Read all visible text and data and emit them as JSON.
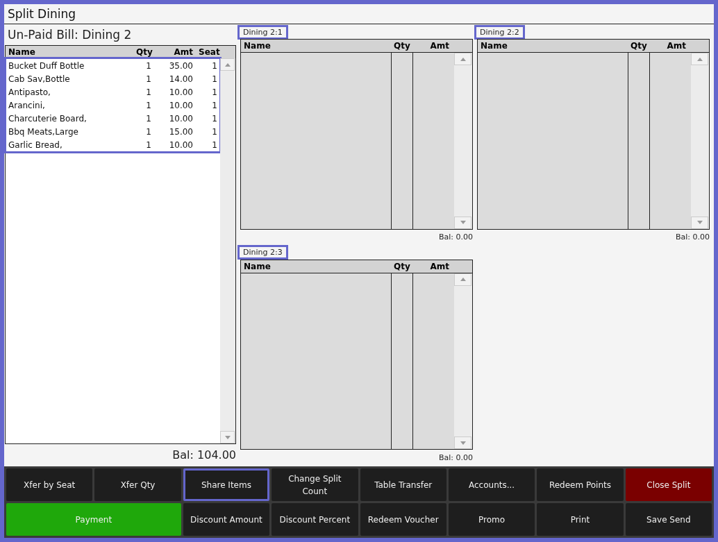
{
  "window": {
    "title": "Split Dining"
  },
  "bill": {
    "title": "Un-Paid Bill: Dining 2",
    "highlighted": true,
    "columns": [
      "Name",
      "Qty",
      "Amt",
      "Seat"
    ],
    "rows": [
      {
        "name": "Bucket Duff Bottle",
        "qty": "1",
        "amt": "35.00",
        "seat": "1"
      },
      {
        "name": "Cab Sav,Bottle",
        "qty": "1",
        "amt": "14.00",
        "seat": "1"
      },
      {
        "name": "Antipasto,",
        "qty": "1",
        "amt": "10.00",
        "seat": "1"
      },
      {
        "name": "Arancini,",
        "qty": "1",
        "amt": "10.00",
        "seat": "1"
      },
      {
        "name": "Charcuterie Board,",
        "qty": "1",
        "amt": "10.00",
        "seat": "1"
      },
      {
        "name": "Bbq Meats,Large",
        "qty": "1",
        "amt": "15.00",
        "seat": "1"
      },
      {
        "name": "Garlic Bread,",
        "qty": "1",
        "amt": "10.00",
        "seat": "1"
      }
    ],
    "balance": "Bal: 104.00"
  },
  "splits": [
    {
      "label": "Dining 2:1",
      "highlighted": true,
      "columns": [
        "Name",
        "Qty",
        "Amt"
      ],
      "balance": "Bal: 0.00"
    },
    {
      "label": "Dining 2:2",
      "highlighted": true,
      "columns": [
        "Name",
        "Qty",
        "Amt"
      ],
      "balance": "Bal: 0.00"
    },
    {
      "label": "Dining 2:3",
      "highlighted": true,
      "columns": [
        "Name",
        "Qty",
        "Amt"
      ],
      "balance": "Bal: 0.00"
    }
  ],
  "buttons": [
    {
      "label": "Xfer by Seat",
      "kind": "normal",
      "highlighted": false
    },
    {
      "label": "Xfer Qty",
      "kind": "normal",
      "highlighted": false
    },
    {
      "label": "Share Items",
      "kind": "normal",
      "highlighted": true
    },
    {
      "label": "Change Split Count",
      "kind": "normal",
      "highlighted": false
    },
    {
      "label": "Table Transfer",
      "kind": "normal",
      "highlighted": false
    },
    {
      "label": "Accounts...",
      "kind": "normal",
      "highlighted": false
    },
    {
      "label": "Redeem Points",
      "kind": "normal",
      "highlighted": false
    },
    {
      "label": "Close Split",
      "kind": "danger",
      "highlighted": false
    },
    {
      "label": "Payment",
      "kind": "primary",
      "highlighted": false
    },
    {
      "label": "Discount Amount",
      "kind": "normal",
      "highlighted": false
    },
    {
      "label": "Discount Percent",
      "kind": "normal",
      "highlighted": false
    },
    {
      "label": "Redeem Voucher",
      "kind": "normal",
      "highlighted": false
    },
    {
      "label": "Promo",
      "kind": "normal",
      "highlighted": false
    },
    {
      "label": "Print",
      "kind": "normal",
      "highlighted": false
    },
    {
      "label": "Save Send",
      "kind": "normal",
      "highlighted": false
    }
  ]
}
